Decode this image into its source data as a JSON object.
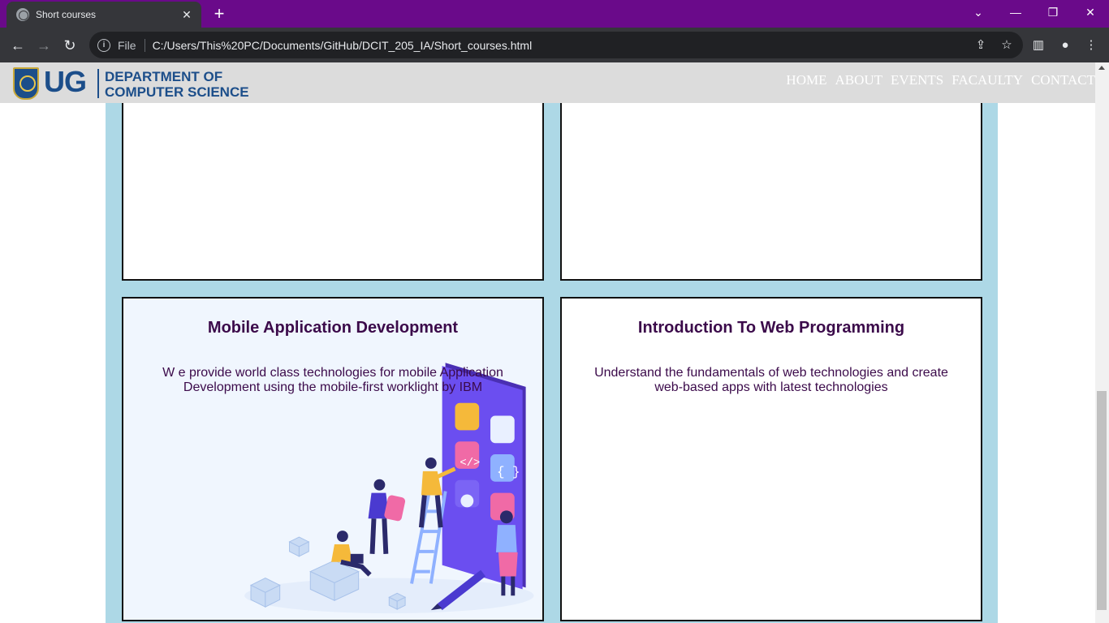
{
  "browser": {
    "tab_title": "Short courses",
    "file_label": "File",
    "url": "C:/Users/This%20PC/Documents/GitHub/DCIT_205_IA/Short_courses.html"
  },
  "site": {
    "logo_text": "UG",
    "department_line1": "DEPARTMENT OF",
    "department_line2": "COMPUTER SCIENCE",
    "nav": [
      "HOME",
      "ABOUT",
      "EVENTS",
      "FACAULTY",
      "CONTACT"
    ]
  },
  "courses": [
    {
      "title": "Mobile Application Development",
      "description": "W e provide world class technologies for mobile Application Development using the mobile-first worklight by IBM"
    },
    {
      "title": "Introduction To Web Programming",
      "description": "Understand the fundamentals of web technologies and create web-based apps with latest technologies"
    }
  ],
  "colors": {
    "tabstrip": "#6a0a8a",
    "content_background": "#add8e6",
    "heading": "#3b0a4a",
    "brand": "#1c4e8a"
  }
}
